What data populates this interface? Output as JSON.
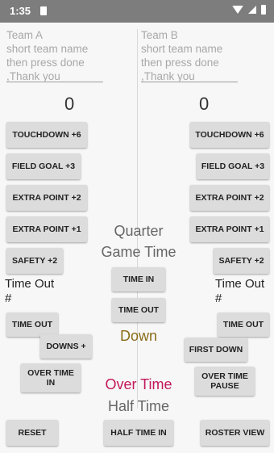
{
  "status_bar": {
    "time": "1:35"
  },
  "team_a": {
    "placeholder": "Team A\nshort team name\nthen press done\n,Thank you",
    "score": "0",
    "buttons": {
      "touchdown": "TOUCHDOWN +6",
      "field_goal": "FIELD GOAL +3",
      "extra_point_2": "EXTRA POINT +2",
      "extra_point_1": "EXTRA POINT +1",
      "safety": "SAFETY +2",
      "time_out": "TIME OUT",
      "downs": "DOWNS +",
      "over_time_in": "OVER TIME IN"
    },
    "time_out_label": "Time Out\n#"
  },
  "team_b": {
    "placeholder": "Team B\nshort team name\nthen press done\n,Thank you",
    "score": "0",
    "buttons": {
      "touchdown": "TOUCHDOWN +6",
      "field_goal": "FIELD GOAL +3",
      "extra_point_2": "EXTRA POINT +2",
      "extra_point_1": "EXTRA POINT +1",
      "safety": "SAFETY +2",
      "time_out": "TIME OUT",
      "first_down": "FIRST DOWN",
      "over_time_pause": "OVER TIME PAUSE"
    },
    "time_out_label": "Time Out\n#"
  },
  "center": {
    "quarter": "Quarter",
    "game_time": "Game Time",
    "time_in": "TIME IN",
    "time_out": "TIME OUT",
    "down": "Down",
    "over_time": "Over Time",
    "half_time": "Half Time",
    "colors": {
      "down": "#8a6d1a",
      "over_time": "#c2185b",
      "label_gray": "#666666"
    }
  },
  "bottom_bar": {
    "reset": "RESET",
    "half_time_in": "HALF TIME IN",
    "roster_view": "ROSTER VIEW"
  }
}
